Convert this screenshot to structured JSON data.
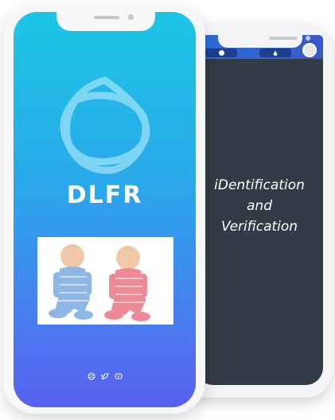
{
  "back_screen": {
    "lines": [
      "iDentification",
      "and",
      "Verification"
    ]
  },
  "front_screen": {
    "brand": "DLFR",
    "photo_subject": "babies-photo",
    "social_icons": [
      "dribbble-icon",
      "twitter-icon",
      "youtube-icon"
    ]
  },
  "colors": {
    "gradient_top": "#1cc6e4",
    "gradient_bottom": "#5662ee",
    "back_bg": "#323b46",
    "back_top": "#2a6fd8"
  }
}
